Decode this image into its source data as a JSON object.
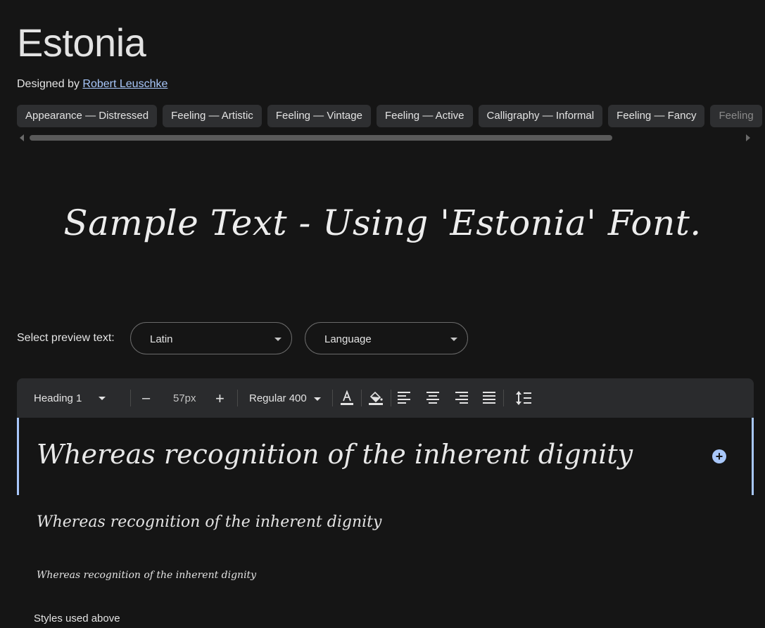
{
  "font": {
    "name": "Estonia",
    "designed_by_label": "Designed by",
    "designer": "Robert Leuschke"
  },
  "tags": [
    "Appearance — Distressed",
    "Feeling — Artistic",
    "Feeling — Vintage",
    "Feeling — Active",
    "Calligraphy — Informal",
    "Feeling — Fancy",
    "Feeling"
  ],
  "sample_text": "Sample Text - Using 'Estonia' Font.",
  "preview": {
    "label": "Select preview text:",
    "script_value": "Latin",
    "language_placeholder": "Language"
  },
  "toolbar": {
    "style": "Heading 1",
    "decrease": "–",
    "size": "57px",
    "increase": "+",
    "weight": "Regular 400"
  },
  "preview_lines": {
    "heading": "Whereas recognition of the inherent dignity",
    "medium": "Whereas recognition of the inherent dignity",
    "small": "Whereas recognition of the inherent dignity"
  },
  "styles_label": "Styles used above",
  "icons": {
    "text_color": "text-color-icon",
    "highlight": "highlight-color-icon",
    "align_left": "align-left-icon",
    "align_center": "align-center-icon",
    "align_right": "align-right-icon",
    "align_justify": "align-justify-icon",
    "line_height": "line-height-icon",
    "add": "add-circle-icon"
  },
  "colors": {
    "background": "#151515",
    "accent": "#a8c7fa",
    "chip": "#2e2f31"
  }
}
